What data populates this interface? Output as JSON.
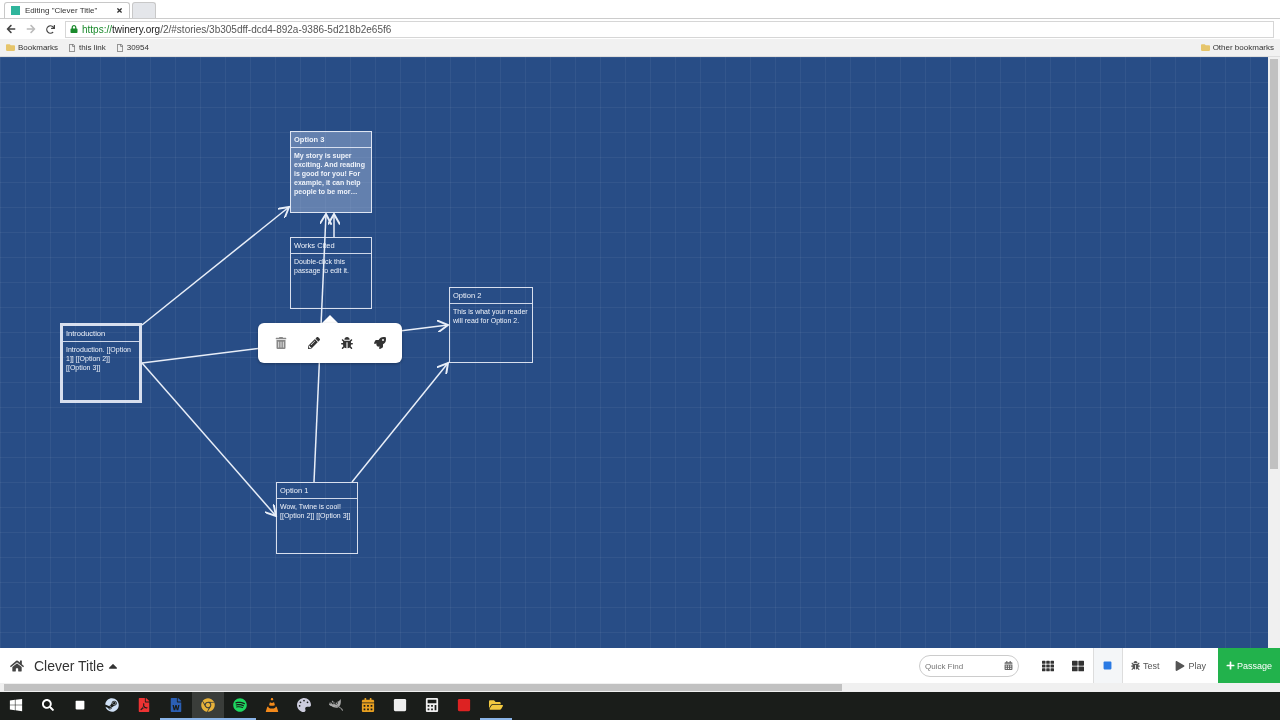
{
  "browser": {
    "tabs": [
      {
        "label": "Editing \"Clever Title\"",
        "selected": true
      },
      {
        "selected": false
      }
    ],
    "url": {
      "secure": "https://",
      "host": "twinery.org",
      "path": "/2/#stories/3b305dff-dcd4-892a-9386-5d218b2e65f6"
    },
    "bookmarks": [
      {
        "kind": "folder",
        "label": "Bookmarks"
      },
      {
        "kind": "page",
        "label": "this link"
      },
      {
        "kind": "page",
        "label": "30954"
      }
    ],
    "other_bookmarks": "Other bookmarks"
  },
  "passages": [
    {
      "title": "Option 3",
      "excerpt": "My story is super exciting. And reading is good for you! For example, it can help people to be mor…",
      "selected": true,
      "start": false
    },
    {
      "title": "Works Cited",
      "excerpt": "Double-click this passage to edit it.",
      "selected": false,
      "start": false
    },
    {
      "title": "Option 2",
      "excerpt": "This is what your reader will read for Option 2.",
      "selected": false,
      "start": false
    },
    {
      "title": "Introduction",
      "excerpt": "Introduction. [[Option 1]] [[Option 2]] [[Option 3]]",
      "selected": false,
      "start": true
    },
    {
      "title": "Option 1",
      "excerpt": "Wow, Twine is cool! [[Option 2]] [[Option 3]]",
      "selected": false,
      "start": false
    }
  ],
  "passage_menu": [
    {
      "kind": "delete"
    },
    {
      "kind": "edit"
    },
    {
      "kind": "test"
    },
    {
      "kind": "start"
    }
  ],
  "story_bar": {
    "title": "Clever Title",
    "quick_find": {
      "placeholder": "Quick Find"
    },
    "zoom_levels": [
      {
        "kind": "small",
        "selected": false
      },
      {
        "kind": "medium",
        "selected": false
      },
      {
        "kind": "large",
        "selected": true
      }
    ],
    "actions": [
      {
        "kind": "test",
        "label": "Test"
      },
      {
        "kind": "play",
        "label": "Play"
      }
    ],
    "add_passage": "Passage"
  },
  "taskbar": [
    {
      "kind": "steam",
      "active": false
    },
    {
      "kind": "pdf",
      "active": false
    },
    {
      "kind": "word",
      "active": true
    },
    {
      "kind": "chrome",
      "active": true
    },
    {
      "kind": "spotify",
      "active": true
    },
    {
      "kind": "vlc",
      "active": false
    },
    {
      "kind": "paint",
      "active": false
    },
    {
      "kind": "gimp",
      "active": false
    },
    {
      "kind": "blob",
      "active": false
    },
    {
      "kind": "zip",
      "active": false
    },
    {
      "kind": "calc",
      "active": false
    },
    {
      "kind": "q",
      "active": false
    },
    {
      "kind": "files",
      "active": true
    }
  ]
}
